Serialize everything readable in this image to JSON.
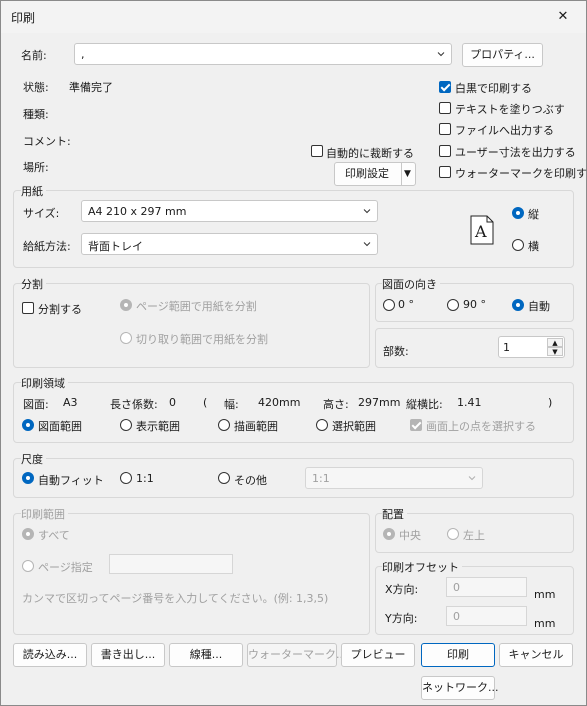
{
  "window": {
    "title": "印刷",
    "close_glyph": "✕"
  },
  "printer": {
    "name_label": "名前:",
    "name_value": ",",
    "properties_button": "プロパティ...",
    "status_label": "状態:",
    "status_value": "準備完了",
    "type_label": "種類:",
    "comment_label": "コメント:",
    "location_label": "場所:",
    "auto_cut_label": "自動的に裁断する",
    "print_settings_button": "印刷設定",
    "print_settings_arrow": "▼"
  },
  "options": {
    "monochrome": "白黒で印刷する",
    "fill_text": "テキストを塗りつぶす",
    "print_to_file": "ファイルへ出力する",
    "user_dimensions": "ユーザー寸法を出力する",
    "watermark": "ウォーターマークを印刷する"
  },
  "paper": {
    "group_label": "用紙",
    "size_label": "サイズ:",
    "size_value": "A4 210 x 297 mm",
    "feed_label": "給紙方法:",
    "feed_value": "背面トレイ",
    "preview_letter": "A",
    "portrait": "縦",
    "landscape": "横"
  },
  "split": {
    "group_label": "分割",
    "split_check": "分割する",
    "by_page_range": "ページ範囲で用紙を分割",
    "by_crop_range": "切り取り範囲で用紙を分割"
  },
  "orientation": {
    "group_label": "図面の向き",
    "deg0": "0 °",
    "deg90": "90 °",
    "auto": "自動"
  },
  "copies": {
    "label": "部数:",
    "value": "1",
    "up": "▲",
    "down": "▼"
  },
  "print_area": {
    "group_label": "印刷領域",
    "sheet_label": "図面:",
    "sheet_value": "A3",
    "scale_label": "長さ係数:",
    "scale_value": "0",
    "open_paren": "(",
    "width_label": "幅:",
    "width_value": "420mm",
    "height_label": "高さ:",
    "height_value": "297mm",
    "ratio_label": "縦横比:",
    "ratio_value": "1.41",
    "close_paren": ")",
    "range_drawing": "図面範囲",
    "range_display": "表示範囲",
    "range_draw": "描画範囲",
    "range_select": "選択範囲",
    "pick_points": "画面上の点を選択する"
  },
  "scale": {
    "group_label": "尺度",
    "auto_fit": "自動フィット",
    "one_to_one": "1:1",
    "other": "その他",
    "other_value": "1:1"
  },
  "page_range": {
    "group_label": "印刷範囲",
    "all": "すべて",
    "specify": "ページ指定",
    "hint": "カンマで区切ってページ番号を入力してください。(例: 1,3,5)"
  },
  "placement": {
    "group_label": "配置",
    "center": "中央",
    "top_left": "左上"
  },
  "offset": {
    "group_label": "印刷オフセット",
    "x_label": "X方向:",
    "x_value": "0",
    "x_unit": "mm",
    "y_label": "Y方向:",
    "y_value": "0",
    "y_unit": "mm"
  },
  "buttons": {
    "load": "読み込み...",
    "save": "書き出し...",
    "line_type": "線種...",
    "watermark": "ウォーターマーク...",
    "preview": "プレビュー",
    "print": "印刷",
    "cancel": "キャンセル",
    "network": "ネットワーク..."
  },
  "colors": {
    "accent": "#0067c0",
    "disabled": "#a0a0a0"
  }
}
